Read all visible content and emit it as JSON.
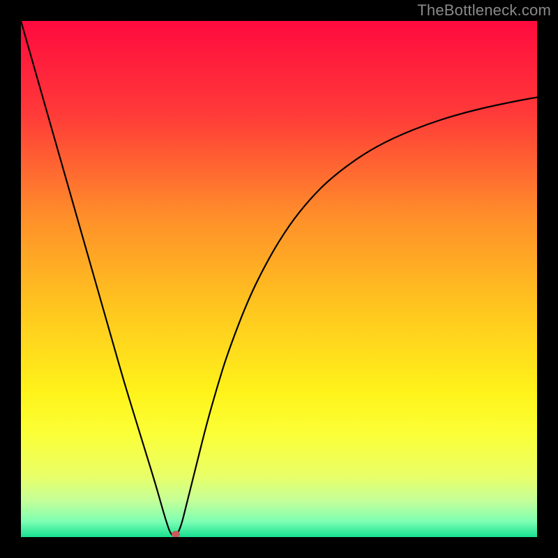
{
  "watermark": "TheBottleneck.com",
  "chart_data": {
    "type": "line",
    "title": "",
    "xlabel": "",
    "ylabel": "",
    "xlim": [
      0,
      100
    ],
    "ylim": [
      0,
      100
    ],
    "grid": false,
    "legend": false,
    "background_gradient": {
      "stops": [
        {
          "offset": 0.0,
          "color": "#ff0a3e"
        },
        {
          "offset": 0.18,
          "color": "#ff3a39"
        },
        {
          "offset": 0.38,
          "color": "#ff8f2a"
        },
        {
          "offset": 0.55,
          "color": "#ffc41f"
        },
        {
          "offset": 0.72,
          "color": "#fff31a"
        },
        {
          "offset": 0.8,
          "color": "#fbff37"
        },
        {
          "offset": 0.88,
          "color": "#eaff66"
        },
        {
          "offset": 0.93,
          "color": "#c4ff99"
        },
        {
          "offset": 0.97,
          "color": "#7dffb3"
        },
        {
          "offset": 1.0,
          "color": "#16e18f"
        }
      ]
    },
    "series": [
      {
        "name": "bottleneck-curve",
        "x": [
          0.0,
          2.0,
          4.0,
          6.0,
          8.0,
          10.0,
          12.0,
          14.0,
          16.0,
          18.0,
          20.0,
          22.0,
          24.0,
          26.0,
          27.0,
          28.0,
          29.0,
          30.0,
          31.0,
          32.0,
          34.0,
          36.0,
          38.0,
          40.0,
          44.0,
          48.0,
          52.0,
          56.0,
          60.0,
          66.0,
          72.0,
          80.0,
          88.0,
          96.0,
          100.0
        ],
        "values": [
          100.0,
          93.0,
          86.0,
          79.0,
          72.0,
          65.0,
          58.0,
          51.0,
          44.0,
          37.0,
          30.0,
          23.5,
          17.0,
          10.5,
          7.0,
          3.5,
          0.5,
          0.0,
          2.0,
          6.0,
          14.0,
          22.0,
          29.0,
          35.5,
          46.0,
          54.0,
          60.5,
          65.5,
          69.5,
          74.0,
          77.3,
          80.5,
          82.8,
          84.5,
          85.2
        ]
      }
    ],
    "marker": {
      "x": 30.0,
      "y": 0.0,
      "color": "#c85a5a"
    }
  }
}
